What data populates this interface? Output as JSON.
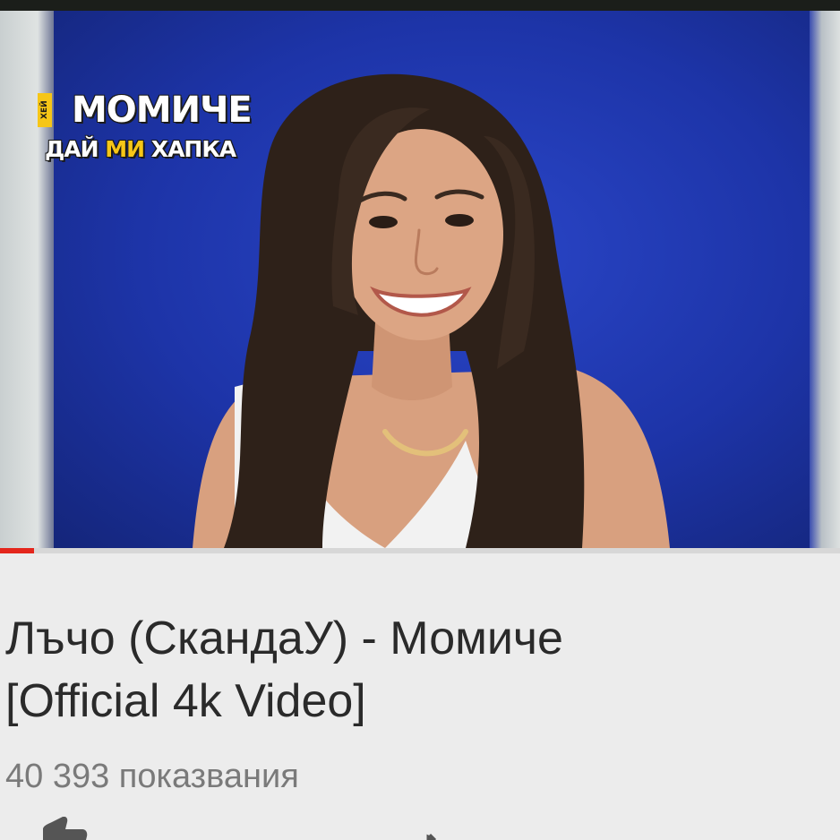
{
  "video": {
    "logo": {
      "vertical": "ХЕЙ",
      "line1": "МОМИЧЕ",
      "line2_a": "ДАЙ",
      "line2_b": "МИ",
      "line2_c": "ХАПКА"
    },
    "progress": 0.04,
    "colors": {
      "backdrop": "#1d34a8",
      "progress": "#e4261c",
      "logo_accent": "#f6c617"
    }
  },
  "title_line1": "Лъчо (СкандаУ) - Момиче",
  "title_line2": "[Official 4k Video]",
  "views": "40 393 показвания",
  "actions": [
    {
      "icon": "thumbs-up-icon"
    },
    {
      "icon": "share-icon"
    }
  ]
}
